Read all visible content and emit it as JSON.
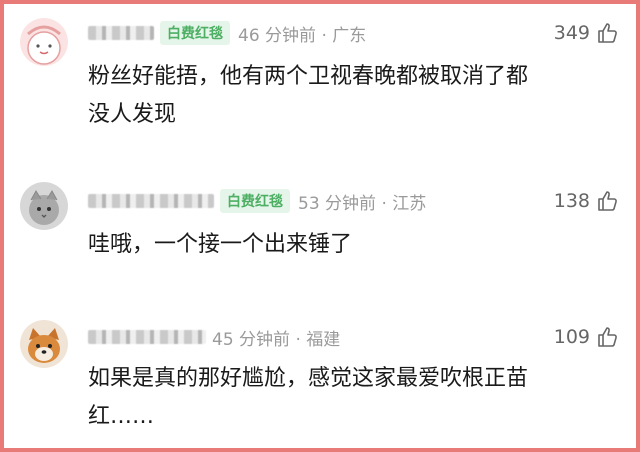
{
  "comments": [
    {
      "badge": "白费红毯",
      "time_location": "46 分钟前 · 广东",
      "likes": "349",
      "text_lines": [
        "粉丝好能捂，他有两个卫视春晚都被取消了都",
        "没人发现"
      ]
    },
    {
      "badge": "白费红毯",
      "time_location": "53 分钟前 · 江苏",
      "likes": "138",
      "text_lines": [
        "哇哦，一个接一个出来锤了"
      ]
    },
    {
      "time_location": "45 分钟前 · 福建",
      "likes": "109",
      "text_lines": [
        "如果是真的那好尴尬，感觉这家最爱吹根正苗",
        "红……"
      ]
    }
  ],
  "icons": {
    "like": "thumbs-up-icon"
  },
  "colors": {
    "border": "#e87a78",
    "badge_text": "#4caf63",
    "badge_bg": "#e6f5e9",
    "meta": "#9a9a9a"
  }
}
